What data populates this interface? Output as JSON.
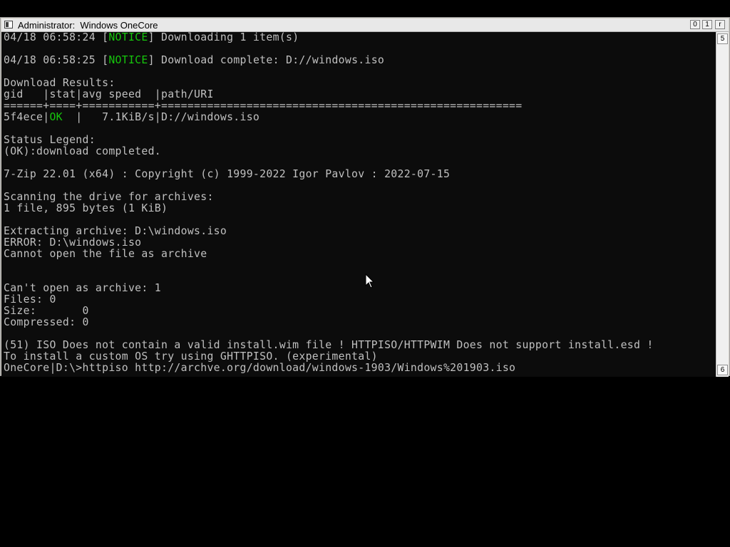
{
  "window": {
    "title": "Administrator:  Windows OneCore",
    "buttons": {
      "minimize": "0",
      "maximize": "1",
      "close": "r"
    }
  },
  "console": {
    "lines": [
      [
        {
          "t": "04/18 06:58:24 ["
        },
        {
          "t": "NOTICE",
          "g": true
        },
        {
          "t": "] Downloading 1 item(s)"
        }
      ],
      [],
      [
        {
          "t": "04/18 06:58:25 ["
        },
        {
          "t": "NOTICE",
          "g": true
        },
        {
          "t": "] Download complete: D://windows.iso"
        }
      ],
      [],
      [
        {
          "t": "Download Results:"
        }
      ],
      [
        {
          "t": "gid   |stat|avg speed  |path/URI"
        }
      ],
      [
        {
          "t": "======+====+===========+======================================================="
        }
      ],
      [
        {
          "t": "5f4ece|"
        },
        {
          "t": "OK",
          "g": true
        },
        {
          "t": "  |   7.1KiB/s|D://windows.iso"
        }
      ],
      [],
      [
        {
          "t": "Status Legend:"
        }
      ],
      [
        {
          "t": "(OK):download completed."
        }
      ],
      [],
      [
        {
          "t": "7-Zip 22.01 (x64) : Copyright (c) 1999-2022 Igor Pavlov : 2022-07-15"
        }
      ],
      [],
      [
        {
          "t": "Scanning the drive for archives:"
        }
      ],
      [
        {
          "t": "1 file, 895 bytes (1 KiB)"
        }
      ],
      [],
      [
        {
          "t": "Extracting archive: D:\\windows.iso"
        }
      ],
      [
        {
          "t": "ERROR: D:\\windows.iso"
        }
      ],
      [
        {
          "t": "Cannot open the file as archive"
        }
      ],
      [],
      [],
      [
        {
          "t": "Can't open as archive: 1"
        }
      ],
      [
        {
          "t": "Files: 0"
        }
      ],
      [
        {
          "t": "Size:       0"
        }
      ],
      [
        {
          "t": "Compressed: 0"
        }
      ],
      [],
      [
        {
          "t": "(51) ISO Does not contain a valid install.wim file ! HTTPISO/HTTPWIM Does not support install.esd !"
        }
      ],
      [
        {
          "t": "To install a custom OS try using GHTTPISO. (experimental)"
        }
      ],
      [
        {
          "t": "OneCore|D:\\>httpiso http://archve.org/download/windows-1903/Windows%201903.iso"
        }
      ]
    ]
  },
  "scrollbar": {
    "up": "5",
    "down": "6"
  },
  "colors": {
    "notice": "#16c60c",
    "text": "#c0c0c0",
    "background": "#0c0c0c"
  },
  "icons": {
    "cursor": "mouse-pointer-icon",
    "system_menu": "system-menu-icon"
  }
}
